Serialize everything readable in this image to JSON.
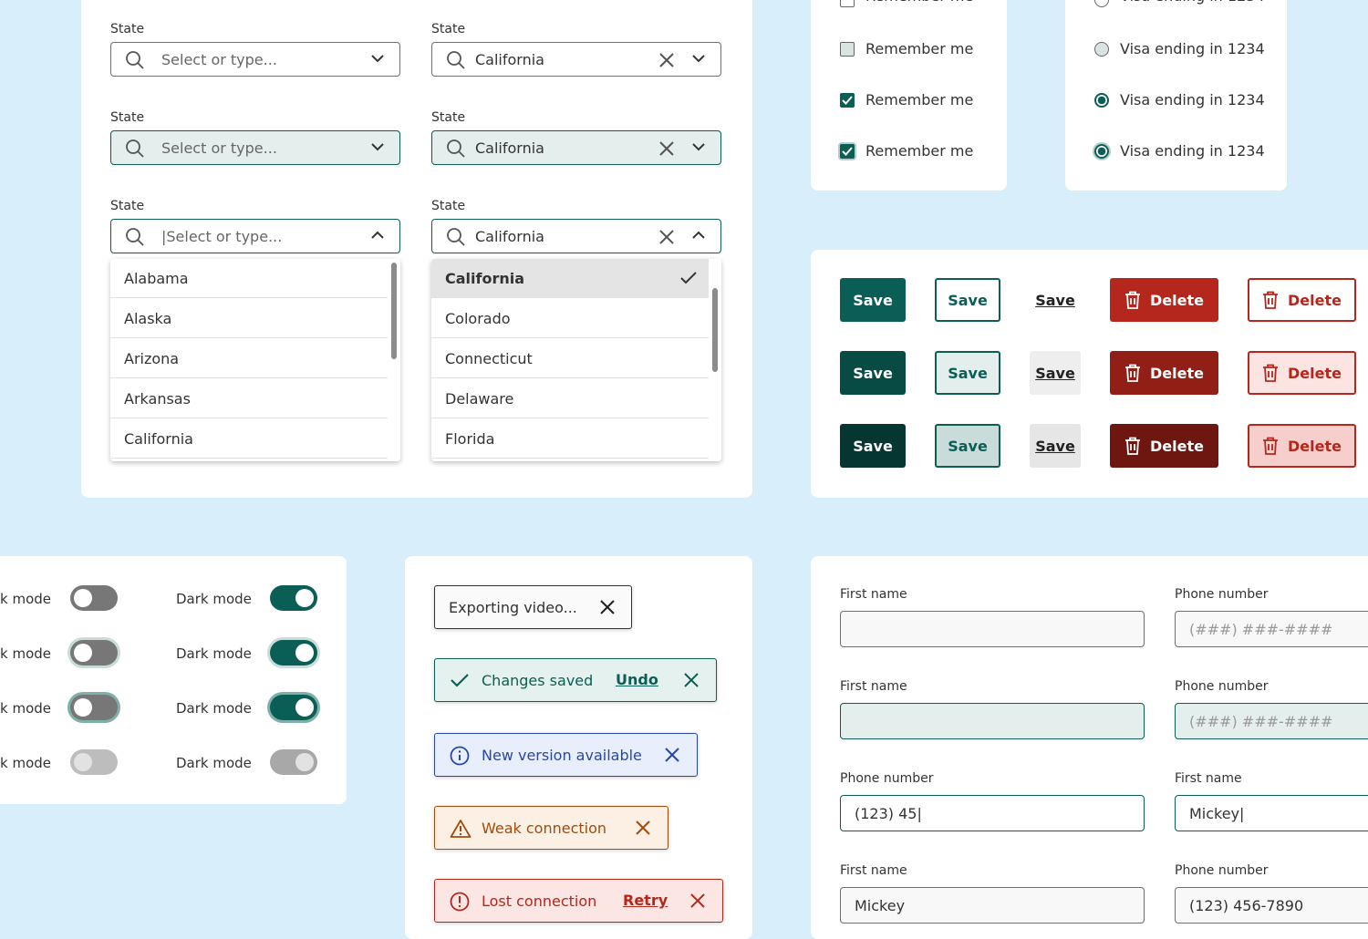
{
  "combos": {
    "label": "State",
    "placeholder": "Select or type...",
    "placeholder_focused": "|Select or type...",
    "selected_value": "California"
  },
  "list_a": [
    "Alabama",
    "Alaska",
    "Arizona",
    "Arkansas",
    "California"
  ],
  "list_b": [
    "California",
    "Colorado",
    "Connecticut",
    "Delaware",
    "Florida"
  ],
  "checkboxes": {
    "label": "Remember me"
  },
  "radios": {
    "label": "Visa ending in 1234"
  },
  "buttons": {
    "save": "Save",
    "delete": "Delete"
  },
  "toggles": {
    "label": "Dark mode",
    "label_cropped": "k mode"
  },
  "toasts": {
    "export": "Exporting video...",
    "saved": "Changes saved",
    "undo": "Undo",
    "info": "New version available",
    "warn": "Weak connection",
    "error": "Lost connection",
    "retry": "Retry"
  },
  "form": {
    "first_name_label": "First name",
    "phone_label": "Phone number",
    "phone_placeholder": "(###) ###-####",
    "phone_typing": "(123) 45|",
    "first_name_typing": "Mickey|",
    "first_name_value": "Mickey",
    "phone_value": "(123) 456-7890"
  },
  "colors": {
    "primary": "#0a5e55",
    "danger": "#b5271c",
    "info": "#2748a8",
    "warning": "#a44a0c",
    "background": "#d9eefb"
  }
}
